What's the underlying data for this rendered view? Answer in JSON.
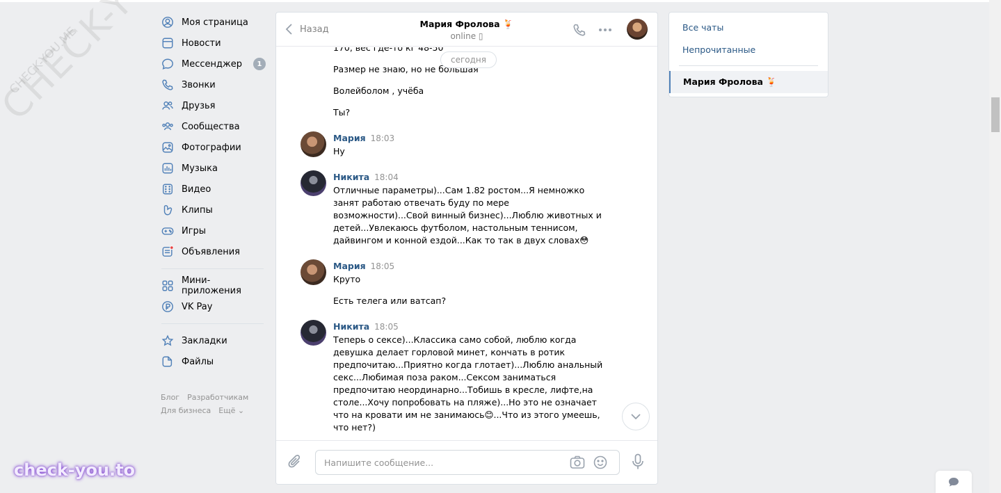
{
  "watermarks": {
    "big": "CHECK-YOU.ME",
    "small": "CHECK-YOU.ME",
    "brand": "check-you.to"
  },
  "sidebar": {
    "items": [
      {
        "label": "Моя страница",
        "icon": "user-circle-icon"
      },
      {
        "label": "Новости",
        "icon": "news-icon"
      },
      {
        "label": "Мессенджер",
        "icon": "messenger-icon",
        "badge": "1"
      },
      {
        "label": "Звонки",
        "icon": "phone-icon"
      },
      {
        "label": "Друзья",
        "icon": "friends-icon"
      },
      {
        "label": "Сообщества",
        "icon": "communities-icon"
      },
      {
        "label": "Фотографии",
        "icon": "photos-icon"
      },
      {
        "label": "Музыка",
        "icon": "music-icon"
      },
      {
        "label": "Видео",
        "icon": "video-icon"
      },
      {
        "label": "Клипы",
        "icon": "clips-icon"
      },
      {
        "label": "Игры",
        "icon": "games-icon"
      },
      {
        "label": "Объявления",
        "icon": "classifieds-icon"
      }
    ],
    "items2": [
      {
        "label": "Мини-приложения",
        "icon": "mini-apps-icon"
      },
      {
        "label": "VK Pay",
        "icon": "vk-pay-icon"
      }
    ],
    "items3": [
      {
        "label": "Закладки",
        "icon": "bookmark-star-icon"
      },
      {
        "label": "Файлы",
        "icon": "files-icon"
      }
    ],
    "footer": {
      "blog": "Блог",
      "devs": "Разработчикам",
      "business": "Для бизнеса",
      "more": "Ещё ⌄"
    }
  },
  "chat": {
    "back_label": "Назад",
    "peer_name": "Мария Фролова 🍹",
    "peer_status": "online",
    "date_pill": "сегодня",
    "messages": [
      {
        "text": "170, вес где-то кг 48-50"
      },
      {
        "text": "Размер не знаю, но не большая"
      },
      {
        "text": "Волейболом , учёба"
      },
      {
        "text": "Ты?"
      },
      {
        "author": "Мария",
        "time": "18:03",
        "text": "Ну"
      },
      {
        "author": "Никита",
        "time": "18:04",
        "text": "Отличные параметры)...Сам 1.82 ростом...Я немножко занят работаю отвечать буду по мере возможности)...Свой винный бизнес)...Люблю животных и детей...Увлекаюсь футболом, настольным теннисом, дайвингом и конной ездой...Как то так в двух словах😳"
      },
      {
        "author": "Мария",
        "time": "18:05",
        "text": "Круто"
      },
      {
        "text": "Есть телега или ватсап?"
      },
      {
        "author": "Никита",
        "time": "18:05",
        "text": "Теперь о сексе)...Классика само собой, люблю когда девушка делает горловой минет, кончать в ротик предпочитаю...Приятно когда глотает)...Люблю анальный секс...Любимая поза раком...Сексом заниматься предпочитаю неординарно...Тобишь в кресле, лифте,на столе...Хочу попробовать на пляже)...Но это не означает что на кровати им не занимаюсь😊...Что из этого умеешь, что нет?)"
      }
    ],
    "composer_placeholder": "Напишите сообщение..."
  },
  "right_panel": {
    "all_chats": "Все чаты",
    "unread": "Непрочитанные",
    "active_chat": "Мария Фролова 🍹"
  },
  "colors": {
    "link": "#2a5885",
    "accent": "#5181b8",
    "bg": "#edeef0"
  }
}
